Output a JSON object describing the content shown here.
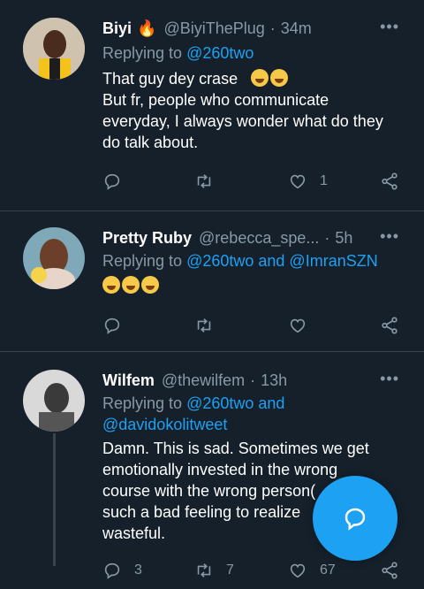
{
  "tweets": [
    {
      "name": "Biyi",
      "name_badge": "🔥",
      "handle": "@BiyiThePlug",
      "time": "34m",
      "replying_label": "Replying to",
      "replying_to": [
        "@260two"
      ],
      "text_lines": [
        "That guy dey crase",
        "But fr, people who communicate",
        "everyday, I always wonder what do they",
        "do talk about."
      ],
      "emoji_count_line1": 2,
      "reply_count": "",
      "retweet_count": "",
      "like_count": "1"
    },
    {
      "name": "Pretty Ruby",
      "handle": "@rebecca_spe...",
      "time": "5h",
      "replying_label": "Replying to",
      "replying_to": [
        "@260two and @ImranSZN"
      ],
      "emoji_only_count": 3,
      "reply_count": "",
      "retweet_count": "",
      "like_count": ""
    },
    {
      "name": "Wilfem",
      "handle": "@thewilfem",
      "time": "13h",
      "replying_label": "Replying to",
      "replying_to": [
        "@260two and",
        "@davidokolitweet"
      ],
      "text_lines": [
        "Damn. This is sad. Sometimes we get",
        "emotionally invested in the wrong",
        "course with the wrong person(",
        "such a bad feeling to realize",
        "wasteful."
      ],
      "reply_count": "3",
      "retweet_count": "7",
      "like_count": "67"
    }
  ],
  "separator": "·",
  "more_glyph": "•••",
  "colors": {
    "background": "#15202b",
    "accent": "#1da1f2",
    "muted": "#8899a6",
    "divider": "#38444d"
  },
  "icons": [
    "reply-icon",
    "retweet-icon",
    "like-icon",
    "share-icon",
    "compose-icon",
    "more-icon"
  ]
}
